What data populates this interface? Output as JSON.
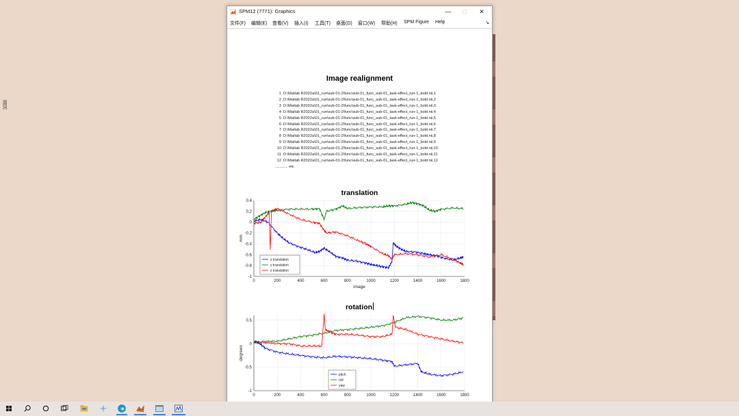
{
  "desktop": {
    "left_mark": "漏洞"
  },
  "window": {
    "title": "SPM12 (7771): Graphics",
    "controls": {
      "minimize": "—",
      "maximize": "□",
      "close": "✕"
    },
    "menu": [
      "文件(F)",
      "编辑(E)",
      "查看(V)",
      "插入(I)",
      "工具(T)",
      "桌面(D)",
      "窗口(W)",
      "帮助(H)",
      "SPM Figure",
      "Help"
    ],
    "menu_overflow": "↘"
  },
  "report": {
    "heading": "Image realignment",
    "files": [
      {
        "n": "1",
        "path": "D:\\Matlab R2022a\\01_run\\sub-01-2\\func\\sub-01_func_sub-01_task-effect_run-1_bold.nii,1"
      },
      {
        "n": "2",
        "path": "D:\\Matlab R2022a\\01_run\\sub-01-2\\func\\sub-01_func_sub-01_task-effect_run-1_bold.nii,2"
      },
      {
        "n": "3",
        "path": "D:\\Matlab R2022a\\01_run\\sub-01-2\\func\\sub-01_func_sub-01_task-effect_run-1_bold.nii,3"
      },
      {
        "n": "4",
        "path": "D:\\Matlab R2022a\\01_run\\sub-01-2\\func\\sub-01_func_sub-01_task-effect_run-1_bold.nii,4"
      },
      {
        "n": "5",
        "path": "D:\\Matlab R2022a\\01_run\\sub-01-2\\func\\sub-01_func_sub-01_task-effect_run-1_bold.nii,5"
      },
      {
        "n": "6",
        "path": "D:\\Matlab R2022a\\01_run\\sub-01-2\\func\\sub-01_func_sub-01_task-effect_run-1_bold.nii,6"
      },
      {
        "n": "7",
        "path": "D:\\Matlab R2022a\\01_run\\sub-01-2\\func\\sub-01_func_sub-01_task-effect_run-1_bold.nii,7"
      },
      {
        "n": "8",
        "path": "D:\\Matlab R2022a\\01_run\\sub-01-2\\func\\sub-01_func_sub-01_task-effect_run-1_bold.nii,8"
      },
      {
        "n": "9",
        "path": "D:\\Matlab R2022a\\01_run\\sub-01-2\\func\\sub-01_func_sub-01_task-effect_run-1_bold.nii,9"
      },
      {
        "n": "10",
        "path": "D:\\Matlab R2022a\\01_run\\sub-01-2\\func\\sub-01_func_sub-01_task-effect_run-1_bold.nii,10"
      },
      {
        "n": "11",
        "path": "D:\\Matlab R2022a\\01_run\\sub-01-2\\func\\sub-01_func_sub-01_task-effect_run-1_bold.nii,11"
      },
      {
        "n": "12",
        "path": "D:\\Matlab R2022a\\01_run\\sub-01-2\\func\\sub-01_func_sub-01_task-effect_run-1_bold.nii,12"
      }
    ],
    "etc": "............ etc"
  },
  "chart_data": [
    {
      "type": "line",
      "title": "translation",
      "xlabel": "image",
      "ylabel": "mm",
      "xlim": [
        0,
        1800
      ],
      "ylim": [
        -1,
        0.4
      ],
      "xticks": [
        0,
        200,
        400,
        600,
        800,
        1000,
        1200,
        1400,
        1600,
        1800
      ],
      "yticks": [
        0.4,
        0.2,
        0,
        -0.2,
        -0.4,
        -0.6,
        -0.8,
        -1
      ],
      "legend": "bottom-left",
      "series": [
        {
          "name": "x translation",
          "color": "#0000ff",
          "x": [
            0,
            60,
            120,
            200,
            250,
            300,
            380,
            450,
            520,
            560,
            600,
            650,
            700,
            760,
            800,
            880,
            950,
            1000,
            1050,
            1100,
            1150,
            1180,
            1190,
            1220,
            1260,
            1300,
            1380,
            1450,
            1500,
            1560,
            1620,
            1700,
            1760,
            1790
          ],
          "y": [
            0.02,
            0.05,
            0.0,
            -0.2,
            -0.3,
            -0.38,
            -0.45,
            -0.5,
            -0.56,
            -0.54,
            -0.48,
            -0.55,
            -0.63,
            -0.66,
            -0.7,
            -0.72,
            -0.75,
            -0.78,
            -0.8,
            -0.82,
            -0.84,
            -0.72,
            -0.38,
            -0.45,
            -0.5,
            -0.54,
            -0.55,
            -0.58,
            -0.6,
            -0.62,
            -0.66,
            -0.7,
            -0.66,
            -0.64
          ]
        },
        {
          "name": "y translation",
          "color": "#008000",
          "x": [
            0,
            50,
            100,
            150,
            200,
            300,
            400,
            500,
            560,
            600,
            620,
            700,
            760,
            800,
            900,
            1000,
            1100,
            1150,
            1200,
            1300,
            1350,
            1400,
            1450,
            1500,
            1550,
            1600,
            1700,
            1790
          ],
          "y": [
            0.05,
            0.12,
            0.18,
            0.2,
            0.22,
            0.24,
            0.24,
            0.24,
            0.25,
            0.05,
            0.2,
            0.24,
            0.3,
            0.25,
            0.27,
            0.28,
            0.28,
            0.3,
            0.3,
            0.33,
            0.36,
            0.34,
            0.3,
            0.22,
            0.2,
            0.24,
            0.26,
            0.25
          ]
        },
        {
          "name": "z translation",
          "color": "#ff0000",
          "x": [
            0,
            60,
            100,
            130,
            140,
            150,
            200,
            300,
            400,
            500,
            560,
            600,
            620,
            700,
            800,
            900,
            960,
            1000,
            1100,
            1150,
            1180,
            1200,
            1300,
            1400,
            1500,
            1600,
            1700,
            1760,
            1790
          ],
          "y": [
            -0.02,
            0.0,
            0.1,
            0.18,
            -0.5,
            0.2,
            0.25,
            0.15,
            0.05,
            0.0,
            -0.02,
            -0.15,
            -0.2,
            -0.18,
            -0.25,
            -0.35,
            -0.4,
            -0.45,
            -0.58,
            -0.62,
            -0.68,
            -0.6,
            -0.58,
            -0.6,
            -0.64,
            -0.6,
            -0.68,
            -0.75,
            -0.78
          ]
        }
      ]
    },
    {
      "type": "line",
      "title": "rotation",
      "xlabel": "",
      "ylabel": "degrees",
      "xlim": [
        0,
        1800
      ],
      "ylim": [
        -1,
        0.6
      ],
      "xticks": [
        0,
        200,
        400,
        600,
        800,
        1000,
        1200,
        1400,
        1600,
        1800
      ],
      "yticks": [
        0.5,
        0,
        -0.5,
        -1
      ],
      "legend": "bottom-center",
      "series": [
        {
          "name": "pitch",
          "color": "#0000ff",
          "x": [
            0,
            50,
            100,
            200,
            300,
            400,
            500,
            600,
            700,
            800,
            900,
            1000,
            1100,
            1180,
            1200,
            1300,
            1400,
            1430,
            1500,
            1600,
            1700,
            1790
          ],
          "y": [
            0.05,
            0.0,
            -0.1,
            -0.18,
            -0.22,
            -0.25,
            -0.28,
            -0.3,
            -0.27,
            -0.28,
            -0.3,
            -0.32,
            -0.35,
            -0.38,
            -0.48,
            -0.45,
            -0.42,
            -0.6,
            -0.65,
            -0.68,
            -0.65,
            -0.6
          ]
        },
        {
          "name": "roll",
          "color": "#008000",
          "x": [
            0,
            100,
            200,
            300,
            400,
            500,
            600,
            700,
            800,
            900,
            1000,
            1100,
            1200,
            1300,
            1400,
            1500,
            1600,
            1700,
            1790
          ],
          "y": [
            0.02,
            0.05,
            0.05,
            0.1,
            0.15,
            0.18,
            0.22,
            0.28,
            0.3,
            0.32,
            0.35,
            0.38,
            0.45,
            0.55,
            0.58,
            0.55,
            0.5,
            0.5,
            0.55
          ]
        },
        {
          "name": "yaw",
          "color": "#ff0000",
          "x": [
            0,
            100,
            200,
            300,
            400,
            500,
            580,
            600,
            610,
            650,
            700,
            800,
            900,
            1000,
            1100,
            1180,
            1190,
            1210,
            1300,
            1400,
            1500,
            1600,
            1700,
            1790
          ],
          "y": [
            0.05,
            0.02,
            0.0,
            0.0,
            -0.05,
            -0.05,
            -0.05,
            0.62,
            0.3,
            0.25,
            0.2,
            0.2,
            0.18,
            0.15,
            0.15,
            0.2,
            0.6,
            0.35,
            0.3,
            0.2,
            0.15,
            0.1,
            0.05,
            0.02
          ]
        }
      ]
    }
  ],
  "taskbar": {
    "items": [
      "windows-start",
      "search",
      "cortana",
      "task-view",
      "file-explorer",
      "app-fan",
      "edge",
      "matlab",
      "app-window",
      "spm-app"
    ]
  }
}
